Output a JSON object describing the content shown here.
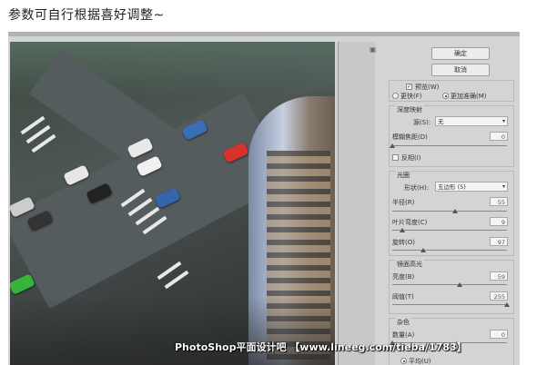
{
  "caption": "参数可自行根据喜好调整~",
  "watermark": "PhotoShop平面设计吧 【www.lineeg.com/tieba/1783】",
  "buttons": {
    "ok": "确定",
    "cancel": "取消"
  },
  "preview": {
    "label": "预览(W)",
    "checked": true
  },
  "quality": {
    "faster": "更快(F)",
    "accurate": "更加准确(M)",
    "selected": "accurate"
  },
  "depth_map": {
    "title": "深度映射",
    "source_label": "源(S):",
    "source_value": "无",
    "focal_label": "模糊焦距(D)",
    "focal_value": "0",
    "focal_level": 0,
    "invert_label": "反相(I)",
    "invert_checked": false
  },
  "iris": {
    "title": "光圈",
    "shape_label": "形状(H):",
    "shape_value": "五边形 (5)",
    "radius_label": "半径(R)",
    "radius_value": "55",
    "radius_level": 0.55,
    "curvature_label": "叶片弯度(C)",
    "curvature_value": "9",
    "curvature_level": 0.09,
    "rotation_label": "旋转(O)",
    "rotation_value": "97",
    "rotation_level": 0.27
  },
  "specular": {
    "title": "镜面高光",
    "brightness_label": "亮度(B)",
    "brightness_value": "59",
    "brightness_level": 0.59,
    "threshold_label": "阈值(T)",
    "threshold_value": "255",
    "threshold_level": 1.0
  },
  "noise": {
    "title": "杂色",
    "amount_label": "数量(A)",
    "amount_value": "0",
    "amount_level": 0,
    "distribution_label": "平均(U)"
  }
}
